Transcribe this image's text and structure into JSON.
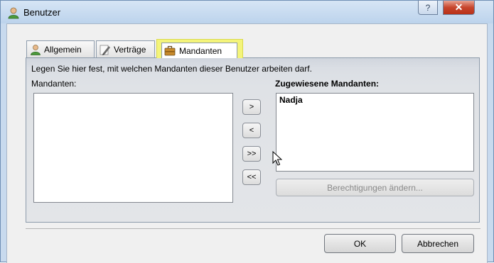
{
  "window": {
    "title": "Benutzer",
    "help_label": "?",
    "close_label": "✕"
  },
  "tabs": [
    {
      "label": "Allgemein",
      "icon": "user-icon"
    },
    {
      "label": "Verträge",
      "icon": "pen-icon"
    },
    {
      "label": "Mandanten",
      "icon": "briefcase-icon",
      "selected": true
    }
  ],
  "panel": {
    "description": "Legen Sie hier fest, mit welchen Mandanten dieser Benutzer arbeiten darf.",
    "available_label": "Mandanten:",
    "assigned_label": "Zugewiesene Mandanten:",
    "available_items": [],
    "assigned_items": [
      "Nadja"
    ],
    "move_buttons": [
      ">",
      "<",
      ">>",
      "<<"
    ],
    "permissions_button": "Berechtigungen ändern...",
    "permissions_enabled": false
  },
  "buttons": {
    "ok": "OK",
    "cancel": "Abbrechen"
  },
  "colors": {
    "highlight": "#f4f47a",
    "titlebar": "#c8daee",
    "close": "#c7452c"
  }
}
